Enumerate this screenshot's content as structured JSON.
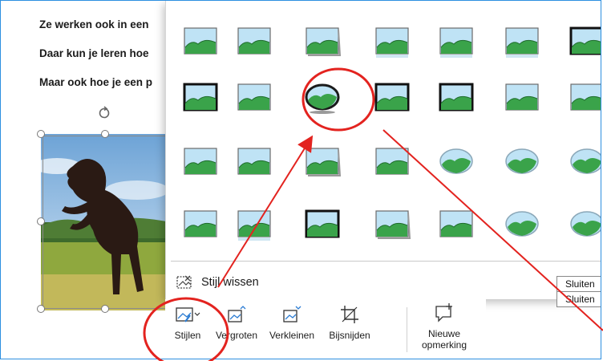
{
  "document": {
    "lines": [
      "Ze werken ook in een",
      "Daar kun je leren hoe",
      "Maar ook hoe je een p"
    ]
  },
  "gallery": {
    "rows": [
      [
        "simple-frame",
        "soft-edge",
        "frame-shadow",
        "reflected",
        "reflected-soft",
        "reflected-bevel",
        "thick-black-frame"
      ],
      [
        "thick-black",
        "simple-white",
        "oval-reflection",
        "double-frame",
        "thin-black",
        "soft-edge-rect",
        "snip-corner"
      ],
      [
        "snip-diagonal",
        "rotated-white",
        "rotated-shadow",
        "perspective",
        "soft-oval",
        "bevel-oval",
        "beveled-round"
      ],
      [
        "skewed",
        "reflected-perspective",
        "metal-frame",
        "center-shadow",
        "relaxed-perspective",
        "rounded-metal",
        "oval-edge"
      ]
    ],
    "clear_style_label": "Stijl wissen"
  },
  "toolbar": {
    "styles_label": "Stijlen",
    "bring_forward_label": "Vergroten",
    "send_backward_label": "Verkleinen",
    "crop_label": "Bijsnijden",
    "new_comment_label": "Nieuwe opmerking"
  },
  "tooltips": [
    "Sluiten",
    "Sluiten"
  ],
  "colors": {
    "accent_border": "#2d8fe0",
    "annotation_red": "#e3231f"
  }
}
